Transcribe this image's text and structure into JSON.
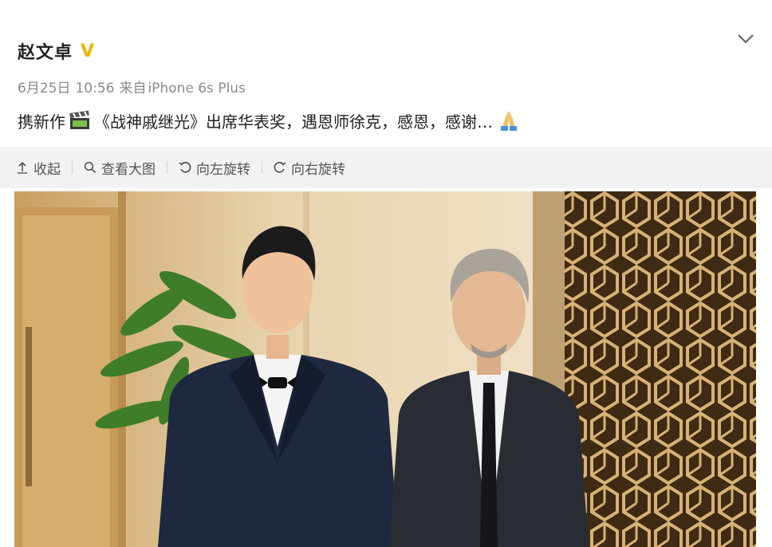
{
  "post": {
    "username": "赵文卓",
    "verified_badge": "V",
    "date": "6月25日",
    "time": "10:56",
    "source_prefix": "来自",
    "source": "iPhone 6s Plus",
    "text_prefix": "携新作",
    "text_main": "《战神戚继光》出席华表奖，遇恩师徐克，感恩，感谢…"
  },
  "toolbar": {
    "collapse_label": "收起",
    "view_large_label": "查看大图",
    "rotate_left_label": "向左旋转",
    "rotate_right_label": "向右旋转"
  },
  "icons": {
    "header_menu": "chevron-down-icon",
    "clapper": "clapperboard-icon",
    "pray": "praying-hands-emoji",
    "collapse": "arrow-up-icon",
    "zoom": "magnifier-icon",
    "rotate_left": "rotate-left-icon",
    "rotate_right": "rotate-right-icon"
  },
  "colors": {
    "verified": "#f2b100",
    "toolbar_bg": "#f2f2f2",
    "meta_text": "#8a8a8a"
  }
}
